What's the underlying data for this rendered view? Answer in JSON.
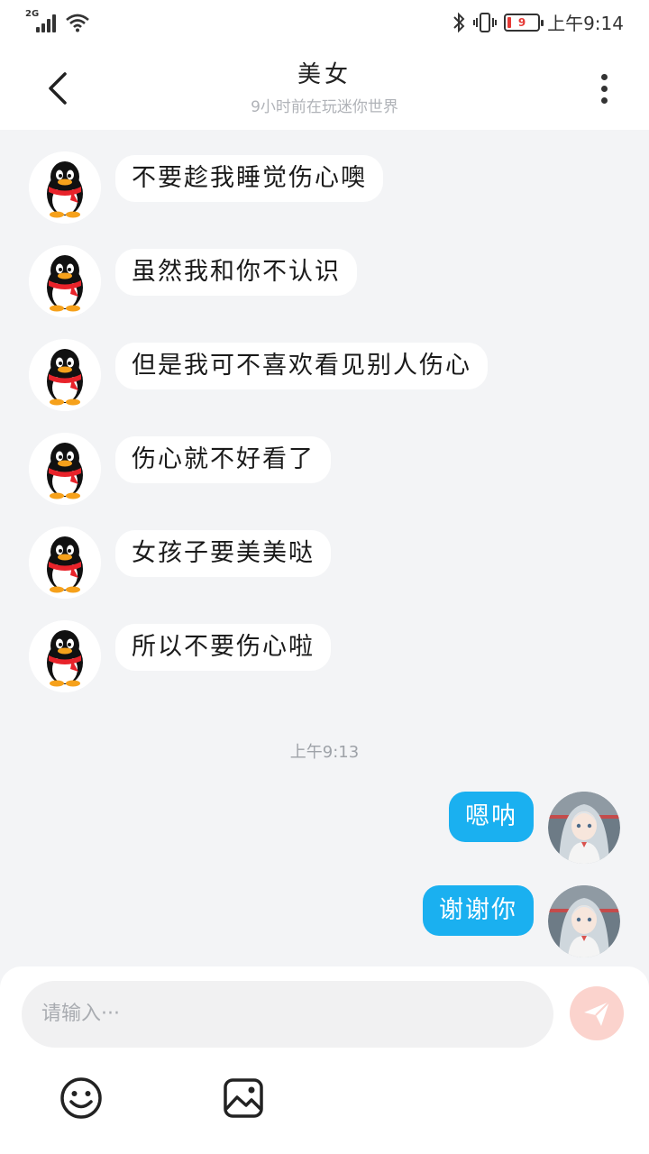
{
  "status_bar": {
    "network": "2G",
    "battery_level": "9",
    "time": "上午9:14"
  },
  "header": {
    "title": "美女",
    "subtitle": "9小时前在玩迷你世界",
    "back_icon": "chevron-left-icon",
    "more_icon": "more-vertical-icon"
  },
  "messages_in": [
    {
      "text": "不要趁我睡觉伤心噢",
      "avatar": "penguin-avatar"
    },
    {
      "text": "虽然我和你不认识",
      "avatar": "penguin-avatar"
    },
    {
      "text": "但是我可不喜欢看见别人伤心",
      "avatar": "penguin-avatar"
    },
    {
      "text": "伤心就不好看了",
      "avatar": "penguin-avatar"
    },
    {
      "text": "女孩子要美美哒",
      "avatar": "penguin-avatar"
    },
    {
      "text": "所以不要伤心啦",
      "avatar": "penguin-avatar"
    }
  ],
  "time_separator": "上午9:13",
  "messages_out": [
    {
      "text": "嗯呐",
      "avatar": "anime-girl-avatar"
    },
    {
      "text": "谢谢你",
      "avatar": "anime-girl-avatar"
    }
  ],
  "composer": {
    "placeholder": "请输入···",
    "send_icon": "paper-plane-icon",
    "emoji_icon": "smiley-icon",
    "image_icon": "image-icon"
  },
  "colors": {
    "outgoing_bubble": "#1ab0f0",
    "incoming_bubble": "#ffffff",
    "chat_background": "#f3f4f6",
    "send_button": "#fbd3cd"
  }
}
